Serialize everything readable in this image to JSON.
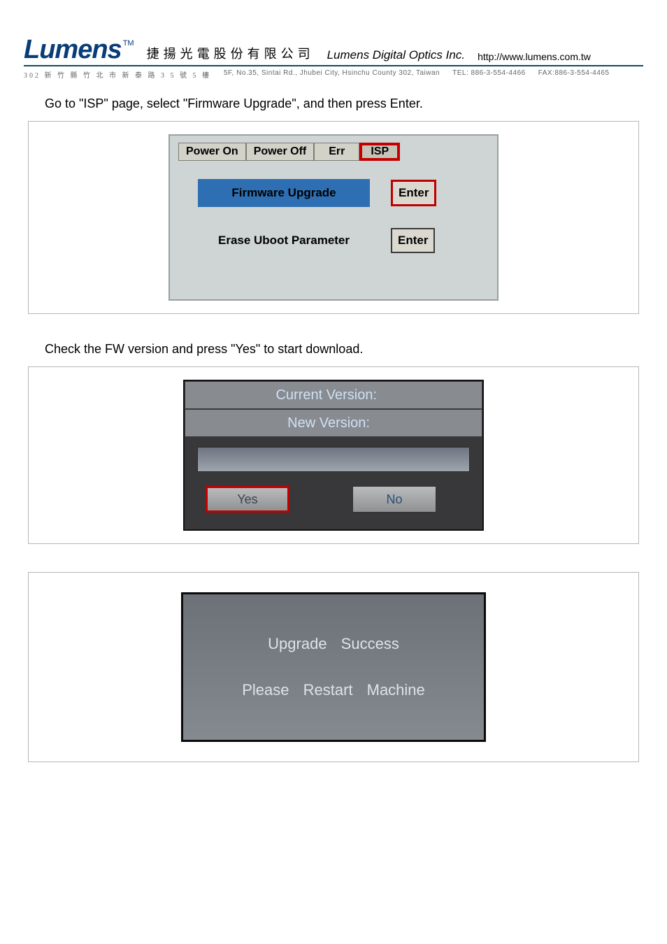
{
  "header": {
    "logo": "Lumens",
    "tm": "TM",
    "company_cjk": "捷揚光電股份有限公司",
    "company_en": "Lumens Digital Optics Inc.",
    "url": "http://www.lumens.com.tw",
    "addr_cn": "302 新 竹 縣 竹 北 市 新 泰 路 3 5 號 5 樓",
    "addr_en": "5F, No.35, Sintai Rd., Jhubei City, Hsinchu County 302, Taiwan",
    "tel": "TEL: 886-3-554-4466",
    "fax": "FAX:886-3-554-4465"
  },
  "step1": {
    "instr": "Go to \"ISP\" page, select \"Firmware Upgrade\", and then press Enter.",
    "tabs": {
      "power_on": "Power On",
      "power_off": "Power Off",
      "err": "Err",
      "isp": "ISP"
    },
    "fw": "Firmware Upgrade",
    "erase": "Erase Uboot Parameter",
    "enter": "Enter"
  },
  "step2": {
    "instr": "Check the FW version and press \"Yes\" to start download.",
    "current": "Current Version:",
    "new_v": "New Version:",
    "yes": "Yes",
    "no": "No"
  },
  "step3": {
    "line1": "Upgrade  Success",
    "line2": "Please  Restart  Machine"
  }
}
